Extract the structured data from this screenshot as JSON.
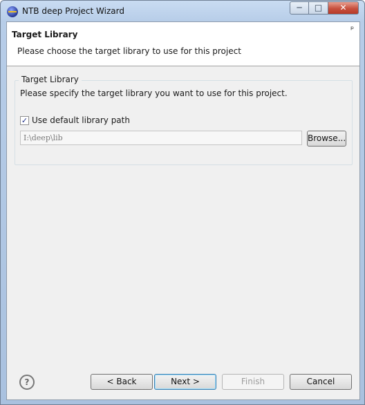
{
  "window": {
    "title": "NTB deep Project Wizard",
    "minimize_symbol": "─",
    "maximize_symbol": "□",
    "close_symbol": "✕"
  },
  "header": {
    "title": "Target Library",
    "description": "Please choose the target library to use for this project",
    "image_symbol": "ᵖ"
  },
  "group": {
    "legend": "Target Library",
    "description": "Please specify the target library you want to use for this project.",
    "checkbox": {
      "label": "Use default library path",
      "checked": true,
      "check_symbol": "✓"
    },
    "path_value": "I:\\deep\\lib",
    "browse_label": "Browse..."
  },
  "footer": {
    "help_symbol": "?",
    "back_label": "< Back",
    "next_label": "Next >",
    "finish_label": "Finish",
    "cancel_label": "Cancel"
  }
}
